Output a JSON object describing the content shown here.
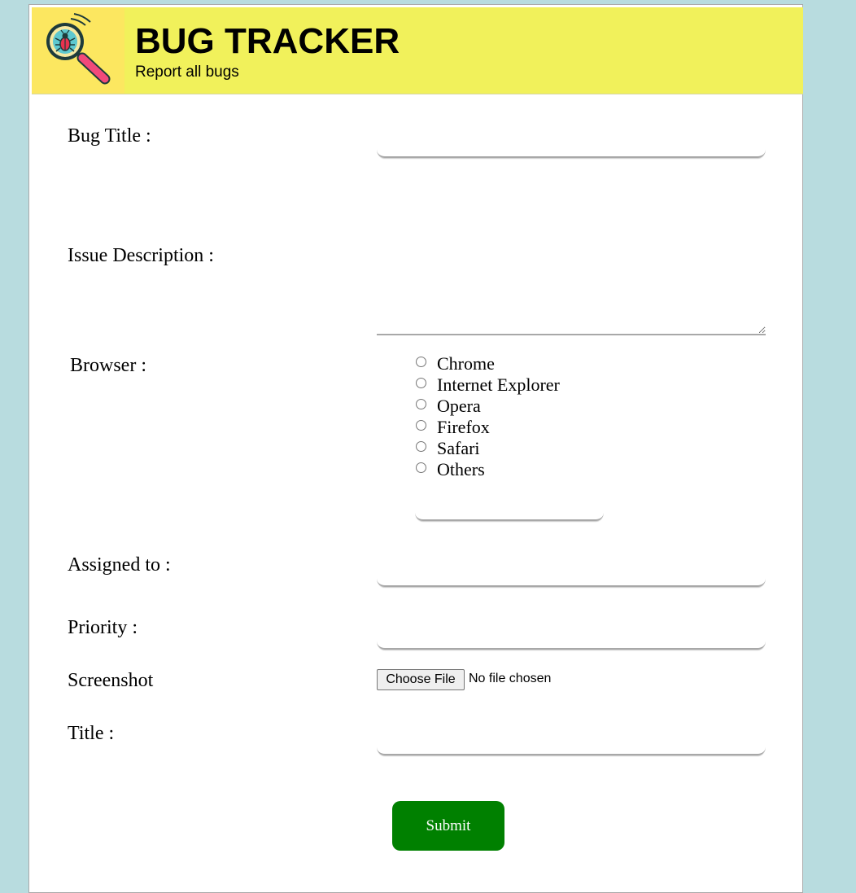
{
  "header": {
    "title": "BUG TRACKER",
    "subtitle": "Report all bugs",
    "logo_icon": "bug-magnifier-icon",
    "background_color": "#f1f15b"
  },
  "form": {
    "bug_title_label": "Bug Title :",
    "bug_title_value": "",
    "issue_description_label": "Issue Description :",
    "issue_description_value": "",
    "browser_label": "Browser :",
    "browser_options": [
      "Chrome",
      "Internet Explorer",
      "Opera",
      "Firefox",
      "Safari",
      "Others"
    ],
    "other_browser_value": "",
    "assigned_to_label": "Assigned to :",
    "assigned_to_value": "",
    "priority_label": "Priority :",
    "priority_value": "",
    "screenshot_label": "Screenshot",
    "choose_file_label": "Choose File",
    "file_status": "No file chosen",
    "title_label": "Title :",
    "title_value": "",
    "submit_label": "Submit"
  },
  "colors": {
    "page_background": "#b8dcdf",
    "submit_background": "#008000"
  }
}
